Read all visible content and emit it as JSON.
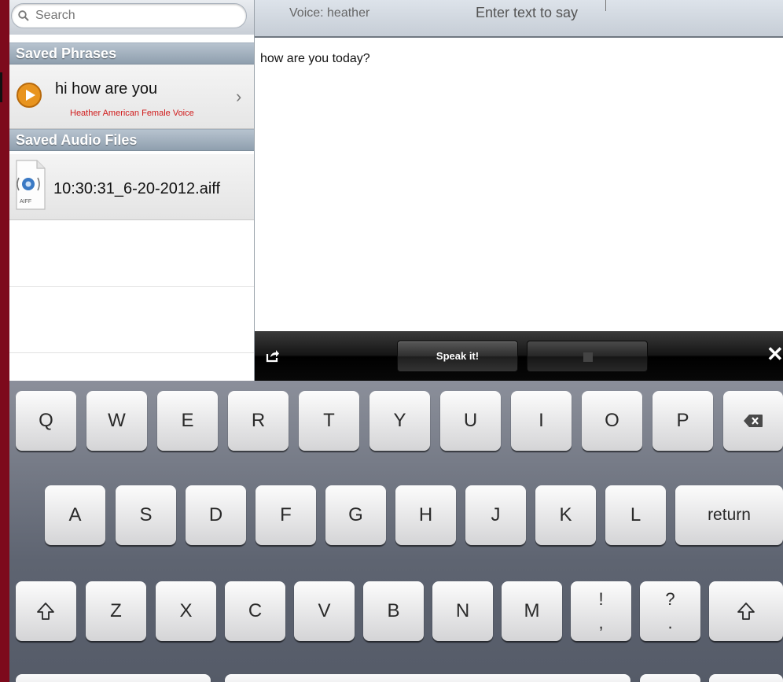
{
  "search": {
    "placeholder": "Search"
  },
  "saved_phrases": {
    "header": "Saved Phrases",
    "items": [
      {
        "text": "hi how are you",
        "voice": "Heather American Female Voice"
      }
    ]
  },
  "saved_audio_files": {
    "header": "Saved Audio Files",
    "items": [
      {
        "filename": "10:30:31_6-20-2012.aiff",
        "icon_label": "AIFF"
      }
    ]
  },
  "editor": {
    "voice_label": "Voice: heather",
    "prompt": "Enter text to say",
    "text": "how are you today?"
  },
  "toolbar": {
    "speak_label": "Speak it!"
  },
  "keyboard": {
    "row1": [
      "Q",
      "W",
      "E",
      "R",
      "T",
      "Y",
      "U",
      "I",
      "O",
      "P"
    ],
    "row2": [
      "A",
      "S",
      "D",
      "F",
      "G",
      "H",
      "J",
      "K",
      "L"
    ],
    "return_label": "return",
    "row3": [
      "Z",
      "X",
      "C",
      "V",
      "B",
      "N",
      "M"
    ],
    "punct1": {
      "top": "!",
      "bottom": ","
    },
    "punct2": {
      "top": "?",
      "bottom": "."
    }
  },
  "colors": {
    "background": "#7d0a1c",
    "voice_text": "#d01a1a",
    "play_icon": "#e8941f"
  },
  "icons": [
    "search-icon",
    "play-icon",
    "chevron-right-icon",
    "audio-file-icon",
    "share-icon",
    "stop-icon",
    "close-icon",
    "backspace-icon",
    "shift-icon"
  ]
}
